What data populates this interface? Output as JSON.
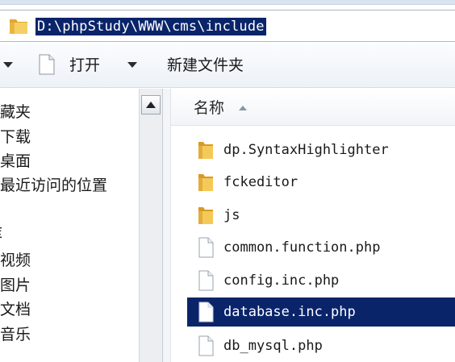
{
  "address": {
    "path": "D:\\phpStudy\\WWW\\cms\\include",
    "folder_icon": "folder-icon"
  },
  "toolbar": {
    "open_label": "打开",
    "new_folder_label": "新建文件夹"
  },
  "nav": {
    "items": [
      "收藏夹",
      "下载",
      "桌面",
      "最近访问的位置",
      "库",
      "视频",
      "图片",
      "文档",
      "音乐"
    ]
  },
  "filelist": {
    "column_name": "名称",
    "files": [
      {
        "name": "dp.SyntaxHighlighter",
        "type": "folder"
      },
      {
        "name": "fckeditor",
        "type": "folder"
      },
      {
        "name": "js",
        "type": "folder"
      },
      {
        "name": "common.function.php",
        "type": "file"
      },
      {
        "name": "config.inc.php",
        "type": "file"
      },
      {
        "name": "database.inc.php",
        "type": "file",
        "selected": true
      },
      {
        "name": "db_mysql.php",
        "type": "file"
      }
    ]
  },
  "colors": {
    "selection": "#0a246a",
    "folder": "#f2c14e"
  }
}
